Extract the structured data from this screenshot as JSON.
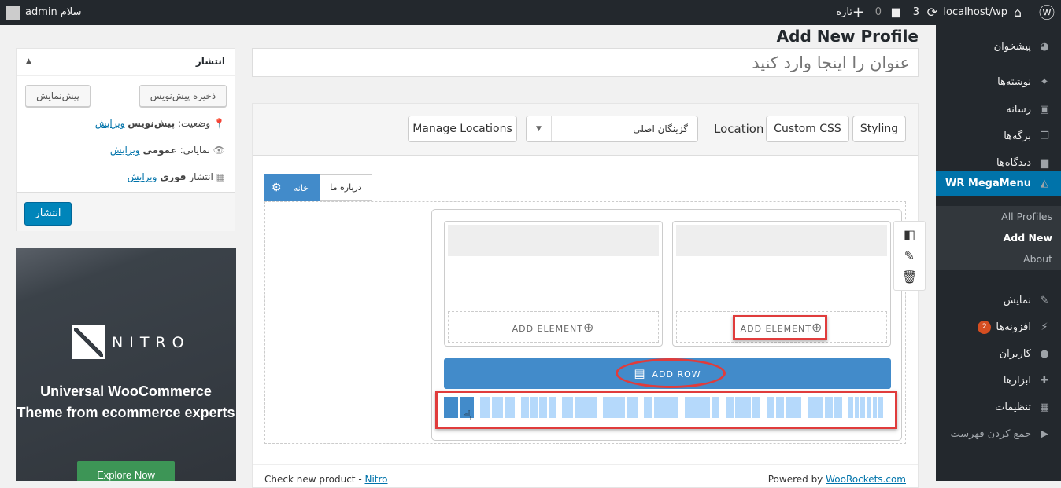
{
  "adminbar": {
    "site": "localhost/wp",
    "updates": "3",
    "comments": "0",
    "new": "تازه",
    "greeting": "سلام admin"
  },
  "sidebar": {
    "items": [
      {
        "label": "پیشخوان",
        "icon": "dashboard-icon"
      },
      {
        "label": "نوشته‌ها",
        "icon": "pin-icon"
      },
      {
        "label": "رسانه",
        "icon": "media-icon"
      },
      {
        "label": "برگه‌ها",
        "icon": "pages-icon"
      },
      {
        "label": "دیدگاه‌ها",
        "icon": "comment-icon"
      },
      {
        "label": "WR MegaMenu",
        "icon": "megamenu-icon",
        "active": true
      },
      {
        "label": "نمایش",
        "icon": "brush-icon"
      },
      {
        "label": "افزونه‌ها",
        "icon": "plugin-icon",
        "badge": "2"
      },
      {
        "label": "کاربران",
        "icon": "user-icon"
      },
      {
        "label": "ابزارها",
        "icon": "wrench-icon"
      },
      {
        "label": "تنظیمات",
        "icon": "settings-icon"
      },
      {
        "label": "جمع کردن فهرست",
        "icon": "collapse-icon"
      }
    ],
    "submenu": [
      "All Profiles",
      "Add New",
      "About"
    ]
  },
  "page": {
    "heading": "Add New Profile",
    "title_placeholder": "عنوان را اینجا وارد کنید"
  },
  "builder": {
    "styling": "Styling",
    "custom_css": "Custom CSS",
    "location_label": "Location",
    "location_select": "گزینگان اصلی",
    "manage_locations": "Manage Locations",
    "tabs": [
      "خانه",
      "درباره ما"
    ],
    "add_element": "ADD ELEMENT",
    "add_row": "ADD ROW",
    "presets": [
      [
        6,
        6
      ],
      [
        4,
        4,
        4
      ],
      [
        3,
        3,
        3,
        3
      ],
      [
        4,
        8
      ],
      [
        8,
        4
      ],
      [
        3,
        9
      ],
      [
        9,
        3
      ],
      [
        3,
        6,
        3
      ],
      [
        3,
        3,
        6
      ],
      [
        6,
        3,
        3
      ],
      [
        2,
        2,
        2,
        2,
        2,
        2
      ]
    ],
    "accent": "#428bca",
    "highlight": "#e03c3c"
  },
  "footer": {
    "left_text": "Check new product - ",
    "left_link": "Nitro",
    "right_text": "Powered by ",
    "right_link": "WooRockets.com"
  },
  "publish": {
    "title": "انتشار",
    "save_draft": "ذخیره پیش‌نویس",
    "preview": "پیش‌نمایش",
    "status_label": "وضعیت:",
    "status_value": "پیش‌نویس",
    "visibility_label": "نمایانی:",
    "visibility_value": "عمومی",
    "schedule_label": "انتشار",
    "schedule_value": "فوری",
    "edit": "ویرایش",
    "publish_button": "انتشار"
  },
  "ad": {
    "logo": "NITRO",
    "headline1": "Universal WooCommerce",
    "headline2": "Theme from ecommerce experts",
    "cta": "Explore Now"
  }
}
